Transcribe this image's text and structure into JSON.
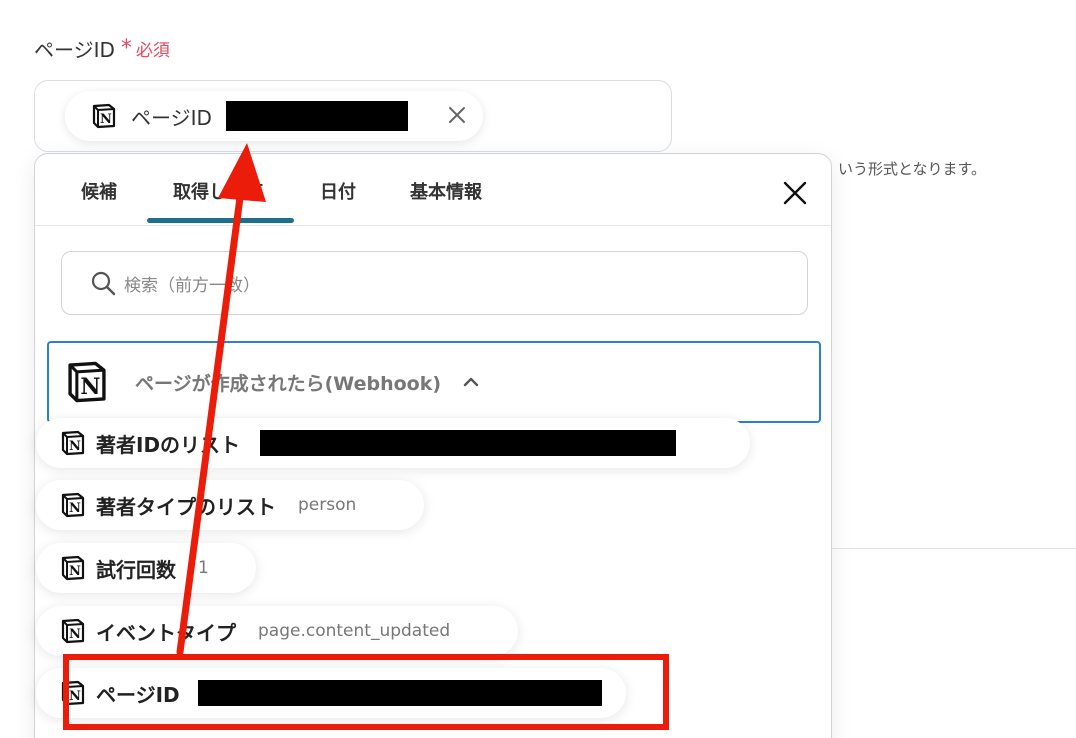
{
  "field": {
    "label": "ページID",
    "required_mark": "*",
    "required_text": "必須",
    "chip_label": "ページID",
    "hint_text": "いう形式となります。"
  },
  "popover": {
    "tabs": [
      {
        "label": "候補"
      },
      {
        "label": "取得した値"
      },
      {
        "label": "日付"
      },
      {
        "label": "基本情報"
      }
    ],
    "active_tab": "取得した値",
    "search_placeholder": "検索（前方一致）",
    "group": {
      "title": "ページが作成されたら(Webhook)",
      "expanded": true
    },
    "items": [
      {
        "label": "著者IDのリスト",
        "value": ""
      },
      {
        "label": "著者タイプのリスト",
        "value": "person"
      },
      {
        "label": "試行回数",
        "value": "1"
      },
      {
        "label": "イベントタイプ",
        "value": "page.content_updated"
      },
      {
        "label": "ページID",
        "value": ""
      }
    ]
  },
  "colors": {
    "required": "#e8475c",
    "tab_underline": "#1d6f8b",
    "group_border": "#2d7fd1",
    "annotation_red": "#ec1c0a"
  },
  "icons": {
    "item_icon": "notion-logo-icon",
    "close": "close-icon",
    "search": "search-icon",
    "chevron": "chevron-up-icon"
  }
}
